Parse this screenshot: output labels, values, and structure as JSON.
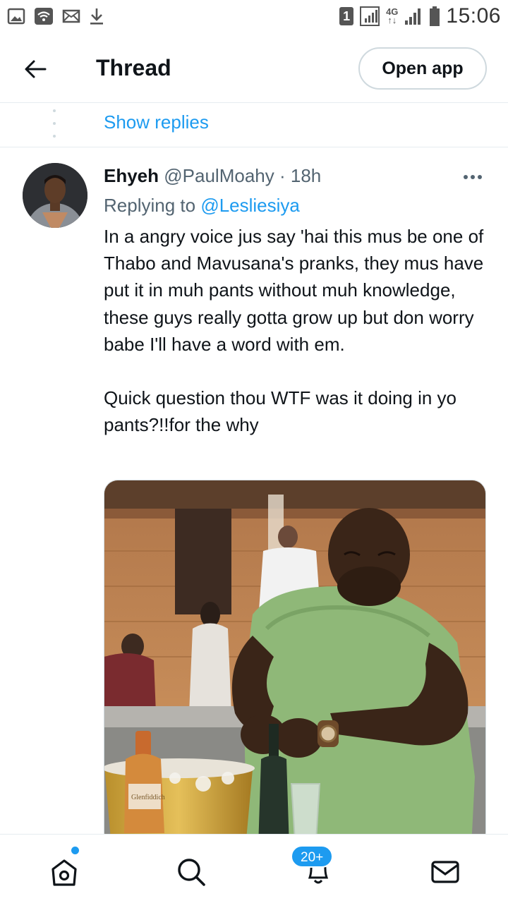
{
  "status_bar": {
    "left_icons": [
      "image-icon",
      "wifi-icon",
      "mail-icon",
      "download-icon"
    ],
    "sim_badge": "1",
    "network": "4G",
    "time": "15:06"
  },
  "header": {
    "title": "Thread",
    "open_app_label": "Open app"
  },
  "thread": {
    "show_replies_label": "Show replies"
  },
  "tweet": {
    "author_name": "Ehyeh",
    "author_handle": "@PaulMoahy",
    "separator": "·",
    "time_ago": "18h",
    "replying_prefix": "Replying to",
    "replying_to": "@Lesliesiya",
    "text": "In a angry voice jus say 'hai this mus be one of Thabo and Mavusana's pranks, they mus have put it in muh pants without muh knowledge, these guys really gotta grow up but don worry babe I'll have a word with em.\n\nQuick question thou WTF was it doing in yo pants?!!for the why",
    "media_label": "Glenfiddich"
  },
  "bottom_nav": {
    "items": [
      "home-icon",
      "search-icon",
      "notifications-icon",
      "messages-icon"
    ],
    "notification_count": "20+"
  },
  "colors": {
    "accent": "#1d9bf0",
    "text": "#0f1419",
    "muted": "#536471",
    "border": "#e6ecf0"
  }
}
